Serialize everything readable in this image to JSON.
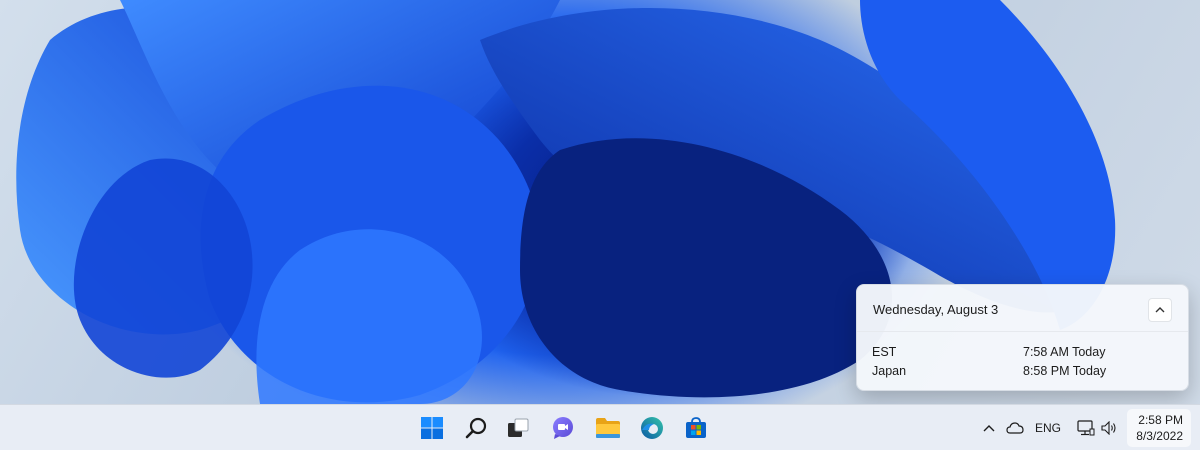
{
  "wallpaper": {
    "name": "bloom-wallpaper",
    "colors": [
      "#1f63f0",
      "#0a2ea8",
      "#061a7a",
      "#c9d6e6"
    ]
  },
  "flyout": {
    "date": "Wednesday, August 3",
    "collapse_icon": "chevron-up-icon",
    "clocks": [
      {
        "label": "EST",
        "time": "7:58 AM Today"
      },
      {
        "label": "Japan",
        "time": "8:58 PM Today"
      }
    ]
  },
  "taskbar": {
    "background": "#e8edf5",
    "apps": [
      "start-icon",
      "search-icon",
      "task-view-icon",
      "chat-icon",
      "file-explorer-icon",
      "edge-icon",
      "store-icon"
    ],
    "tray": {
      "language": "ENG",
      "icons": [
        "chevron-up-icon",
        "onedrive-icon",
        "network-icon",
        "volume-icon"
      ]
    },
    "clock": {
      "time": "2:58 PM",
      "date": "8/3/2022"
    }
  }
}
